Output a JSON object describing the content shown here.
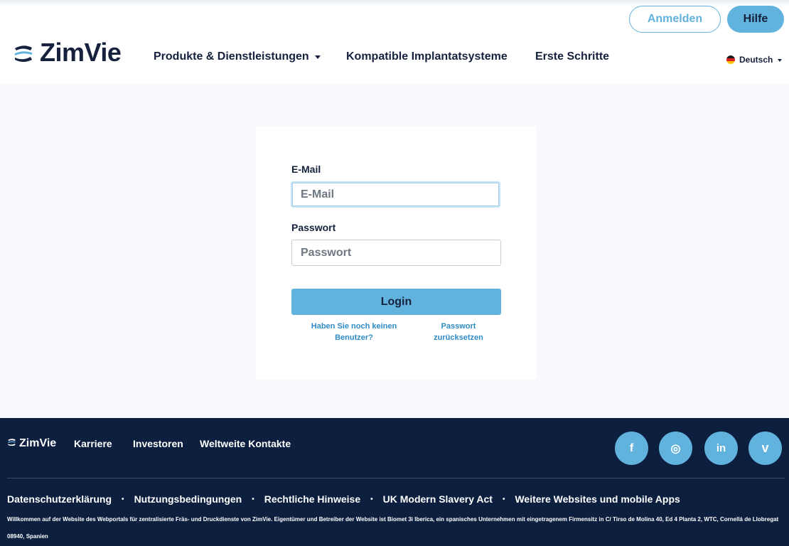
{
  "header": {
    "login_button": "Anmelden",
    "help_button": "Hilfe",
    "logo_text": "ZimVie",
    "nav": [
      {
        "label": "Produkte & Dienstleistungen"
      },
      {
        "label": "Kompatible Implantatsysteme"
      },
      {
        "label": "Erste Schritte"
      }
    ],
    "language": "Deutsch"
  },
  "form": {
    "email_label": "E-Mail",
    "email_placeholder": "E-Mail",
    "password_label": "Passwort",
    "password_placeholder": "Passwort",
    "login_button": "Login",
    "no_user_link_line1": "Haben Sie noch keinen",
    "no_user_link_line2": "Benutzer?",
    "reset_link_line1": "Passwort",
    "reset_link_line2": "zurücksetzen"
  },
  "footer": {
    "logo_text": "ZimVie",
    "links": [
      "Karriere",
      "Investoren",
      "Weltweite Kontakte"
    ],
    "social": [
      {
        "icon": "facebook-icon",
        "glyph": "f"
      },
      {
        "icon": "instagram-icon",
        "glyph": "◎"
      },
      {
        "icon": "linkedin-icon",
        "glyph": "in"
      },
      {
        "icon": "vimeo-icon",
        "glyph": "v"
      }
    ],
    "legal": [
      "Datenschutzerklärung",
      "Nutzungsbedingungen",
      "Rechtliche Hinweise",
      "UK Modern Slavery Act",
      "Weitere Websites und mobile Apps"
    ],
    "legal_separator": "•",
    "notice": "Willkommen auf der Website des Webportals für zentralisierte Fräs- und Druckdienste von ZimVie. Eigentümer und Betreiber der Website ist Biomet 3i Iberica, ein spanisches Unternehmen mit eingetragenem Firmensitz in C/ Tirso de Molina 40, Ed 4 Planta 2, WTC, Cornellá de Llobregat 08940, Spanien"
  },
  "colors": {
    "accent": "#62b2de",
    "navy": "#0c1f3f",
    "text": "#16213d",
    "link": "#2f8bc6",
    "page_bg": "#f7f9fc"
  }
}
